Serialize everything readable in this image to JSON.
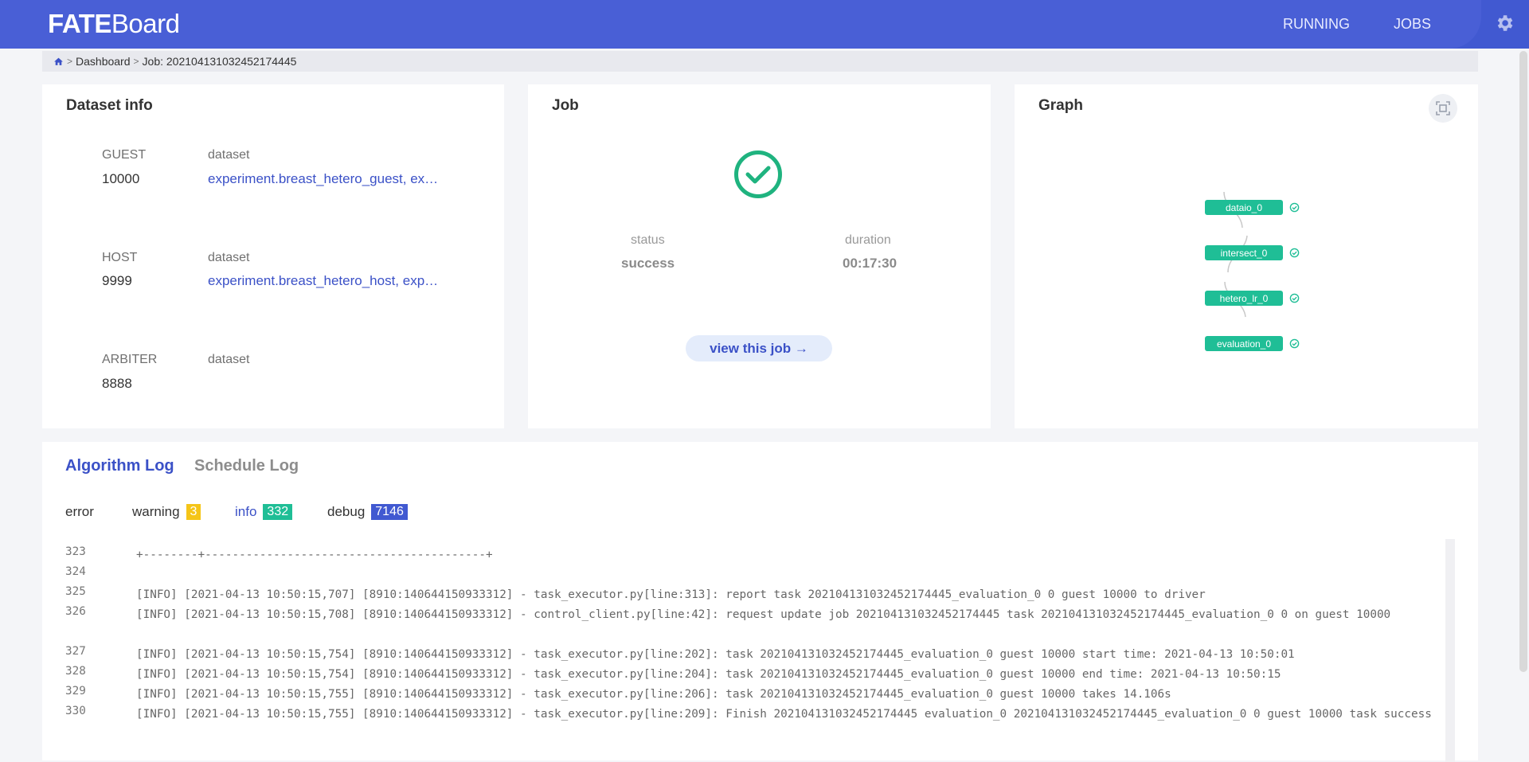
{
  "header": {
    "logo_bold": "FATE",
    "logo_light": "Board",
    "nav": [
      {
        "label": "RUNNING"
      },
      {
        "label": "JOBS"
      }
    ],
    "settings_icon": "gear-icon",
    "bar_color": "#495fd6"
  },
  "breadcrumb": {
    "home_icon": "home-icon",
    "items": [
      "Dashboard",
      "Job: 202104131032452174445"
    ]
  },
  "dataset_info": {
    "title": "Dataset info",
    "rows": [
      {
        "role": "GUEST",
        "label": "dataset",
        "count": "10000",
        "name": "experiment.breast_hetero_guest, experiment.breast_hetero_guest"
      },
      {
        "role": "HOST",
        "label": "dataset",
        "count": "9999",
        "name": "experiment.breast_hetero_host, experiment.breast_hetero_host"
      },
      {
        "role": "ARBITER",
        "label": "dataset",
        "count": "8888",
        "name": ""
      }
    ]
  },
  "job": {
    "title": "Job",
    "status_icon": "check-circle-icon",
    "status_label": "status",
    "status_value": "success",
    "duration_label": "duration",
    "duration_value": "00:17:30",
    "view_button": "view this job →",
    "success_color": "#1fb37f"
  },
  "graph": {
    "title": "Graph",
    "fit_icon": "fit-screen-icon",
    "nodes": [
      {
        "label": "dataio_0",
        "status_icon": "check-circle-icon"
      },
      {
        "label": "intersect_0",
        "status_icon": "check-circle-icon"
      },
      {
        "label": "hetero_lr_0",
        "status_icon": "check-circle-icon"
      },
      {
        "label": "evaluation_0",
        "status_icon": "check-circle-icon"
      }
    ],
    "node_color": "#1fbe96"
  },
  "logs": {
    "tabs": [
      {
        "label": "Algorithm Log",
        "active": true
      },
      {
        "label": "Schedule Log",
        "active": false
      }
    ],
    "levels": [
      {
        "label": "error",
        "count": "",
        "color": ""
      },
      {
        "label": "warning",
        "count": "3",
        "color": "#f5c518"
      },
      {
        "label": "info",
        "count": "332",
        "color": "#1fbe96"
      },
      {
        "label": "debug",
        "count": "7146",
        "color": "#4159d1"
      }
    ],
    "lines": [
      {
        "no": "323",
        "text": "+--------+-----------------------------------------+"
      },
      {
        "no": "324",
        "text": ""
      },
      {
        "no": "325",
        "text": "[INFO] [2021-04-13 10:50:15,707] [8910:140644150933312] - task_executor.py[line:313]: report task 202104131032452174445_evaluation_0 0 guest 10000 to driver"
      },
      {
        "no": "326",
        "text": "[INFO] [2021-04-13 10:50:15,708] [8910:140644150933312] - control_client.py[line:42]: request update job 202104131032452174445 task 202104131032452174445_evaluation_0 0 on guest 10000"
      },
      {
        "no": "327",
        "text": "[INFO] [2021-04-13 10:50:15,754] [8910:140644150933312] - task_executor.py[line:202]: task 202104131032452174445_evaluation_0 guest 10000 start time: 2021-04-13 10:50:01"
      },
      {
        "no": "328",
        "text": "[INFO] [2021-04-13 10:50:15,754] [8910:140644150933312] - task_executor.py[line:204]: task 202104131032452174445_evaluation_0 guest 10000 end time: 2021-04-13 10:50:15"
      },
      {
        "no": "329",
        "text": "[INFO] [2021-04-13 10:50:15,755] [8910:140644150933312] - task_executor.py[line:206]: task 202104131032452174445_evaluation_0 guest 10000 takes 14.106s"
      },
      {
        "no": "330",
        "text": "[INFO] [2021-04-13 10:50:15,755] [8910:140644150933312] - task_executor.py[line:209]: Finish 202104131032452174445 evaluation_0 202104131032452174445_evaluation_0 0 guest 10000 task success"
      }
    ]
  }
}
